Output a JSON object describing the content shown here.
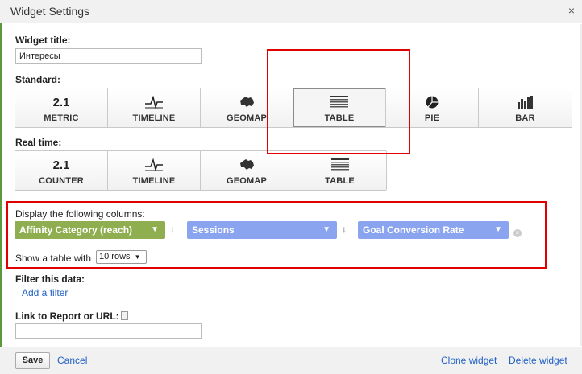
{
  "dialog": {
    "title": "Widget Settings",
    "close_glyph": "×"
  },
  "widget_title": {
    "label": "Widget title:",
    "value": "Интересы"
  },
  "standard": {
    "label": "Standard:",
    "buttons": [
      {
        "glyph": "2.1",
        "caption": "METRIC",
        "icon": "metric-icon"
      },
      {
        "glyph": "",
        "caption": "TIMELINE",
        "icon": "timeline-icon"
      },
      {
        "glyph": "",
        "caption": "GEOMAP",
        "icon": "geomap-icon"
      },
      {
        "glyph": "",
        "caption": "TABLE",
        "icon": "table-icon",
        "selected": true
      },
      {
        "glyph": "",
        "caption": "PIE",
        "icon": "pie-icon"
      },
      {
        "glyph": "",
        "caption": "BAR",
        "icon": "bar-chart-icon"
      }
    ]
  },
  "realtime": {
    "label": "Real time:",
    "buttons": [
      {
        "glyph": "2.1",
        "caption": "COUNTER",
        "icon": "counter-icon"
      },
      {
        "glyph": "",
        "caption": "TIMELINE",
        "icon": "timeline-icon"
      },
      {
        "glyph": "",
        "caption": "GEOMAP",
        "icon": "geomap-icon"
      },
      {
        "glyph": "",
        "caption": "TABLE",
        "icon": "table-icon"
      }
    ]
  },
  "columns": {
    "label": "Display the following columns:",
    "items": [
      {
        "value": "Affinity Category (reach)",
        "color": "#8fae4f"
      },
      {
        "value": "Sessions",
        "color": "#8aa4f0"
      },
      {
        "value": "Goal Conversion Rate",
        "color": "#8aa4f0"
      }
    ],
    "show_table_label": "Show a table with",
    "rows_value": "10 rows"
  },
  "filter": {
    "label": "Filter this data:",
    "add_link": "Add a filter"
  },
  "link_report": {
    "label": "Link to Report or URL:",
    "value": ""
  },
  "footer": {
    "save": "Save",
    "cancel": "Cancel",
    "clone": "Clone widget",
    "delete": "Delete widget"
  },
  "colors": {
    "highlight": "#e00000",
    "link": "#2262c6"
  }
}
